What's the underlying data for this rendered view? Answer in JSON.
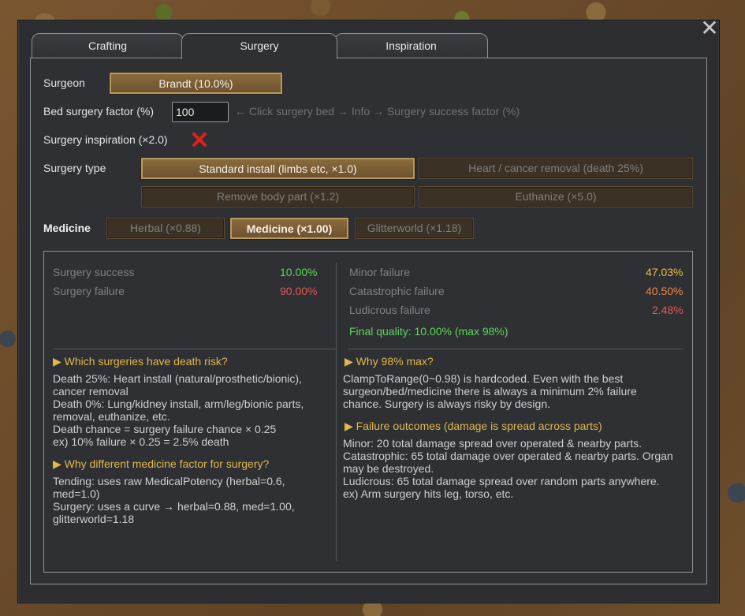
{
  "tabs": [
    "Crafting",
    "Surgery",
    "Inspiration"
  ],
  "surgeon": {
    "label": "Surgeon",
    "value": "Brandt  (10.0%)"
  },
  "bed": {
    "label": "Bed surgery factor (%)",
    "value": "100",
    "hint": "← Click surgery bed → Info → Surgery success factor (%)"
  },
  "inspiration": {
    "label": "Surgery inspiration (×2.0)",
    "checked": false
  },
  "surgery_type": {
    "label": "Surgery type",
    "options": [
      "Standard install (limbs etc, ×1.0)",
      "Heart / cancer removal (death 25%)",
      "Remove body part (×1.2)",
      "Euthanize (×5.0)"
    ],
    "selected": 0
  },
  "medicine": {
    "label": "Medicine",
    "options": [
      "Herbal (×0.88)",
      "Medicine (×1.00)",
      "Glitterworld (×1.18)"
    ],
    "selected": 1
  },
  "stats_left": [
    {
      "label": "Surgery success",
      "value": "10.00%",
      "color": "#5fd65a"
    },
    {
      "label": "Surgery failure",
      "value": "90.00%",
      "color": "#e15a55"
    }
  ],
  "stats_right": [
    {
      "label": "Minor failure",
      "value": "47.03%",
      "color": "#e8c14a"
    },
    {
      "label": "Catastrophic failure",
      "value": "40.50%",
      "color": "#e8894c"
    },
    {
      "label": "Ludicrous failure",
      "value": "2.48%",
      "color": "#e15a55"
    }
  ],
  "final_quality": "Final quality: 10.00% (max 98%)",
  "sections": {
    "death_risk": {
      "title": "▶ Which surgeries have death risk?",
      "body": "Death 25%: Heart install (natural/prosthetic/bionic),\ncancer removal\nDeath 0%: Lung/kidney install, arm/leg/bionic parts,\nremoval, euthanize, etc.\nDeath chance = surgery failure chance × 0.25\n  ex) 10% failure × 0.25 = 2.5% death"
    },
    "medicine_factor": {
      "title": "▶ Why different medicine factor for surgery?",
      "body": "Tending: uses raw MedicalPotency (herbal=0.6,\nmed=1.0)\nSurgery: uses a curve → herbal=0.88, med=1.00,\nglitterworld=1.18"
    },
    "why_max": {
      "title": "▶ Why 98% max?",
      "body": "ClampToRange(0~0.98) is hardcoded. Even with the best\nsurgeon/bed/medicine there is always a minimum 2% failure\nchance. Surgery is always risky by design."
    },
    "failure_outcomes": {
      "title": "▶ Failure outcomes (damage is spread across parts)",
      "body": "Minor: 20 total damage spread over operated & nearby parts.\nCatastrophic: 65 total damage over operated & nearby parts. Organ\nmay be destroyed.\nLudicrous: 65 total damage spread over random parts anywhere.\n  ex) Arm surgery hits leg, torso, etc."
    }
  }
}
